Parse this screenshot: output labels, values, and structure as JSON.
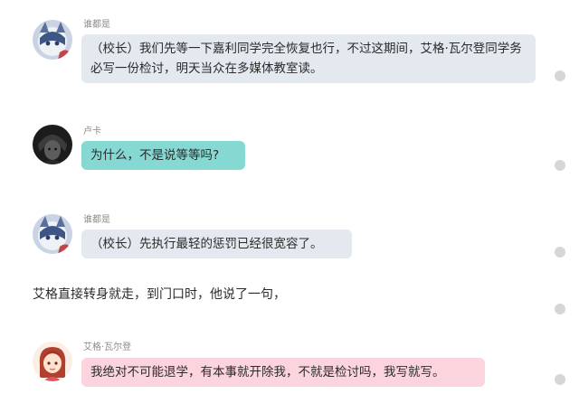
{
  "messages": [
    {
      "speaker": "谁都是",
      "avatar": "avatar-cat-ears",
      "text": "（校长）我们先等一下嘉利同学完全恢复也行，不过这期间，艾格·瓦尔登同学务必写一份检讨，明天当众在多媒体教室读。"
    },
    {
      "speaker": "卢卡",
      "avatar": "avatar-dark-boy",
      "text": "为什么，不是说等等吗?"
    },
    {
      "speaker": "谁都是",
      "avatar": "avatar-cat-ears",
      "text": "（校长）先执行最轻的惩罚已经很宽容了。"
    },
    {
      "narration": "艾格直接转身就走，到门口时，他说了一句，"
    },
    {
      "speaker": "艾格·瓦尔登",
      "avatar": "avatar-red-hair-girl",
      "text": "我绝对不可能退学，有本事就开除我，不就是检讨吗，我写就写。"
    }
  ],
  "colors": {
    "bubble_gray": "#e4e8ef",
    "bubble_teal": "#86d8d2",
    "bubble_pink": "#fcd4de",
    "name_text": "#8a8a8a",
    "scroll_dot": "#d6d6d6"
  },
  "icons": [
    "avatar-cat-ears",
    "avatar-dark-boy",
    "avatar-red-hair-girl",
    "scroll-dot"
  ]
}
